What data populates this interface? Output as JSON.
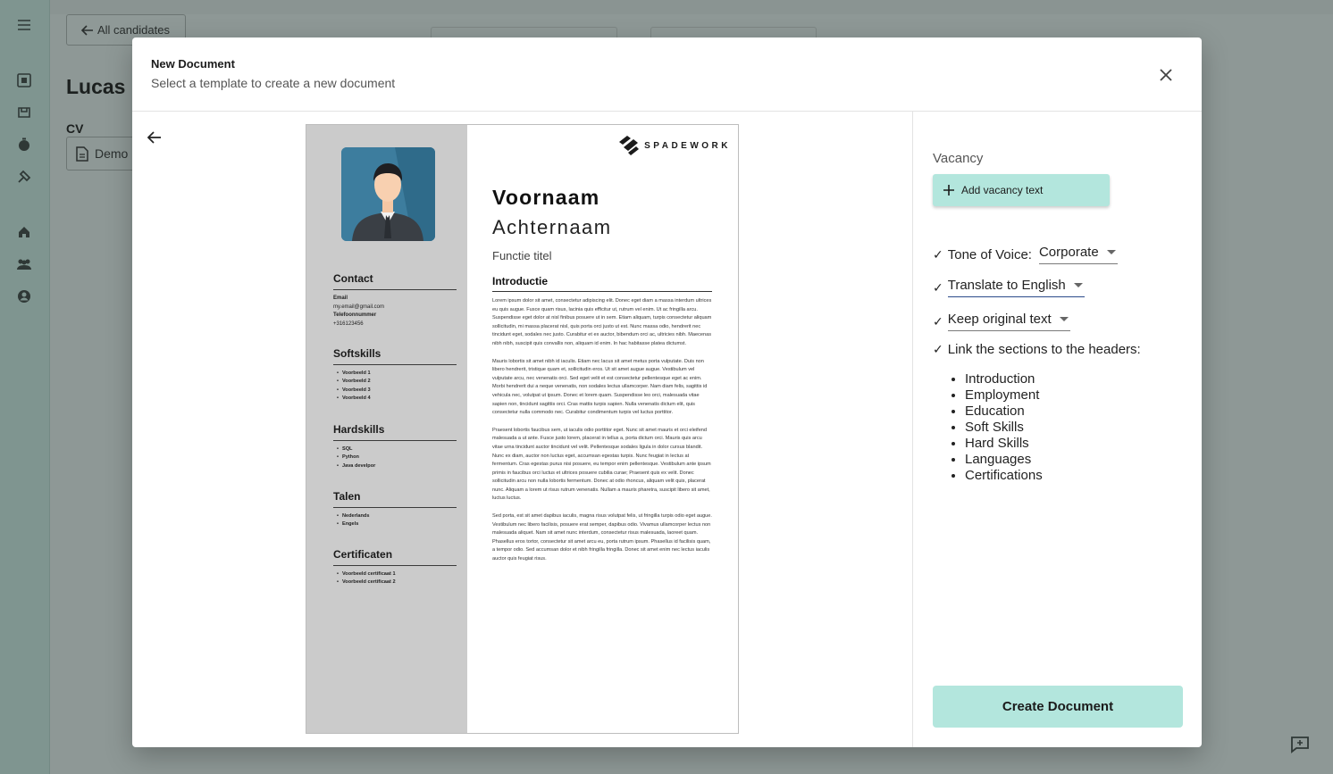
{
  "background": {
    "back_label": "All candidates",
    "candidate_name": "Lucas B",
    "cv_label": "CV",
    "cv_file": "Demo"
  },
  "modal": {
    "title": "New Document",
    "subtitle": "Select a template to create a new document"
  },
  "preview": {
    "logo_text": "SPADEWORK",
    "first_name": "Voornaam",
    "last_name": "Achternaam",
    "function_title": "Functie titel",
    "contact": {
      "title": "Contact",
      "email_label": "Email",
      "email_value": "my.email@gmail.com",
      "phone_label": "Telefoonnummer",
      "phone_value": "+316123456"
    },
    "softskills": {
      "title": "Softskills",
      "items": [
        "Voorbeeld 1",
        "Voorbeeld 2",
        "Voorbeeld 3",
        "Voorbeeld 4"
      ]
    },
    "hardskills": {
      "title": "Hardskills",
      "items": [
        "SQL",
        "Python",
        "Java develpor"
      ]
    },
    "talen": {
      "title": "Talen",
      "items": [
        "Nederlands",
        "Engels"
      ]
    },
    "certificaten": {
      "title": "Certificaten",
      "items": [
        "Voorbeeld certificaat 1",
        "Voorbeeld certificaat 2"
      ]
    },
    "intro_title": "Introductie",
    "paragraphs": [
      "Lorem ipsum dolor sit amet, consectetur adipiscing elit. Donec eget diam a massa interdum ultrices eu quis augue. Fusce quam risus, lacinia quis efficitur ut, rutrum vel enim. Ut ac fringilla arcu. Suspendisse eget dolor at nisl finibus posuere ut in sem. Etiam aliquam, turpis consectetur aliquam sollicitudin, mi massa placerat nisl, quis porta orci justo ut est. Nunc massa odio, hendrerit nec tincidunt eget, sodales nec justo. Curabitur et ex auctor, bibendum orci ac, ultricies nibh. Maecenas nibh nibh, suscipit quis convallis non, aliquam id enim. In hac habitasse platea dictumst.",
      "Mauris lobortis sit amet nibh id iaculis. Etiam nec lacus sit amet metus porta vulputate. Duis non libero hendrerit, tristique quam et, sollicitudin eros. Ut sit amet augue augue. Vestibulum vel vulputate arcu, nec venenatis orci. Sed eget velit et est consectetur pellentesque eget ac enim. Morbi hendrerit dui a neque venenatis, non sodales lectus ullamcorper. Nam diam felis, sagittis id vehicula nec, volutpat ut ipsum. Donec et lorem quam. Suspendisse leo orci, malesuada vitae sapien non, tincidunt sagittis orci. Cras mattis turpis sapien. Nulla venenatis dictum elit, quis consectetur nulla commodo nec. Curabitur condimentum turpis vel luctus porttitor.",
      "Praesent lobortis faucibus sem, ut iaculis odio porttitor eget. Nunc sit amet mauris et orci eleifend malesuada a ut ante. Fusce justo lorem, placerat in tellus a, porta dictum orci. Mauris quis arcu vitae urna tincidunt auctor tincidunt vel velit. Pellentesque sodales ligula in dolor cursus blandit. Nunc ex diam, auctor non luctus eget, accumsan egestas turpis. Nunc feugiat in lectus at fermentum. Cras egestas purus nisi posuere, eu tempor enim pellentesque. Vestibulum ante ipsum primis in faucibus orci luctus et ultrices posuere cubilia curae; Praesent quis ex velit. Donec sollicitudin arcu non nulla lobortis fermentum. Donec at odio rhoncus, aliquam velit quis, placerat nunc. Aliquam a lorem ut risus rutrum venenatis. Nullam a mauris pharetra, suscipit libero sit amet, luctus luctus.",
      "Sed porta, est sit amet dapibus iaculis, magna risus volutpat felis, ut fringilla turpis odio eget augue. Vestibulum nec libero facilisis, posuere erat semper, dapibus odio. Vivamus ullamcorper lectus non malesuada aliquet. Nam sit amet nunc interdum, consectetur risus malesuada, laoreet quam. Phasellus eros tortor, consectetur sit amet arcu eu, porta rutrum ipsum. Phasellus id facilisis quam, a tempor odio. Sed accumsan dolor et nibh fringilla fringilla. Donec sit amet enim nec lectus iaculis auctor quis feugiat risus."
    ]
  },
  "options": {
    "vacancy_label": "Vacancy",
    "add_vacancy_label": "Add vacancy text",
    "check_mark": "✓",
    "tone_label": "Tone of Voice:",
    "tone_value": "Corporate",
    "translate_value": "Translate to English",
    "keep_value": "Keep original text",
    "link_label": "Link the sections to the headers:",
    "headers": [
      "Introduction",
      "Employment",
      "Education",
      "Soft Skills",
      "Hard Skills",
      "Languages",
      "Certifications"
    ],
    "create_label": "Create Document"
  },
  "colors": {
    "accent": "#b3e6dd",
    "sidebar": "#7f9590",
    "overlay": "#8e9896"
  }
}
